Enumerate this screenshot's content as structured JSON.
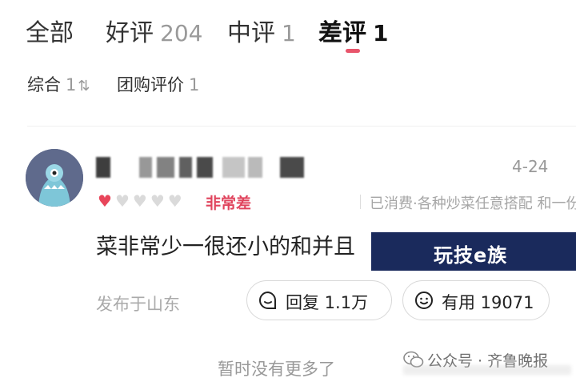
{
  "tabs": [
    {
      "label": "全部",
      "count": ""
    },
    {
      "label": "好评",
      "count": "204"
    },
    {
      "label": "中评",
      "count": "1"
    },
    {
      "label": "差评",
      "count": "1",
      "active": true
    }
  ],
  "subtabs": [
    {
      "label": "综合",
      "count": "1",
      "icon": "sort-icon"
    },
    {
      "label": "团购评价",
      "count": "1"
    }
  ],
  "review": {
    "date": "4-24",
    "rating": {
      "filled": 1,
      "total": 5,
      "label": "非常差"
    },
    "tags": "已消费·各种炒菜任意搭配 和一份香米...",
    "text": "菜非常少一很还小的和并且",
    "location": "发布于山东",
    "reply_label": "回复 1.1万",
    "useful_label": "有用 19071"
  },
  "overlay_watermark": "玩技e族",
  "footer": "暂时没有更多了",
  "source_watermark": "公众号 · 齐鲁晚报",
  "colors": {
    "accent": "#e8556b",
    "watermark_bg": "#1a2a5c"
  }
}
